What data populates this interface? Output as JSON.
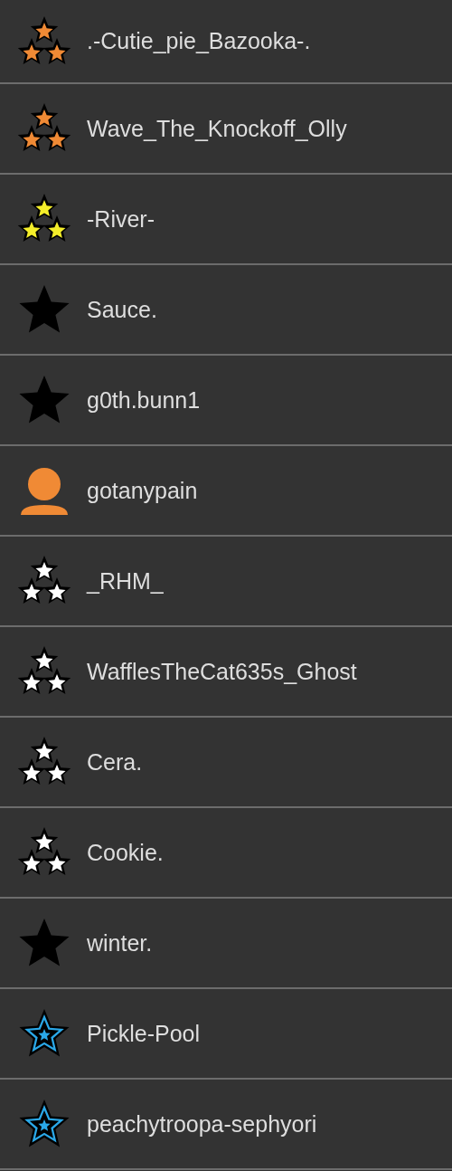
{
  "users": [
    {
      "name": ".-Cutie_pie_Bazooka-.",
      "kind": "triple-star",
      "color": "#f08a35"
    },
    {
      "name": "Wave_The_Knockoff_Olly",
      "kind": "triple-star",
      "color": "#f08a35"
    },
    {
      "name": "-River-",
      "kind": "triple-star",
      "color": "#f4ee2a"
    },
    {
      "name": "Sauce.",
      "kind": "star"
    },
    {
      "name": "g0th.bunn1",
      "kind": "star"
    },
    {
      "name": "gotanypain",
      "kind": "person",
      "color": "#f08a35"
    },
    {
      "name": "_RHM_",
      "kind": "triple-star",
      "color": "#ffffff"
    },
    {
      "name": "WafflesTheCat635s_Ghost",
      "kind": "triple-star",
      "color": "#ffffff"
    },
    {
      "name": "Cera.",
      "kind": "triple-star",
      "color": "#ffffff"
    },
    {
      "name": "Cookie.",
      "kind": "triple-star",
      "color": "#ffffff"
    },
    {
      "name": "winter.",
      "kind": "star"
    },
    {
      "name": "Pickle-Pool",
      "kind": "outline-star"
    },
    {
      "name": "peachytroopa-sephyori",
      "kind": "outline-star"
    }
  ]
}
